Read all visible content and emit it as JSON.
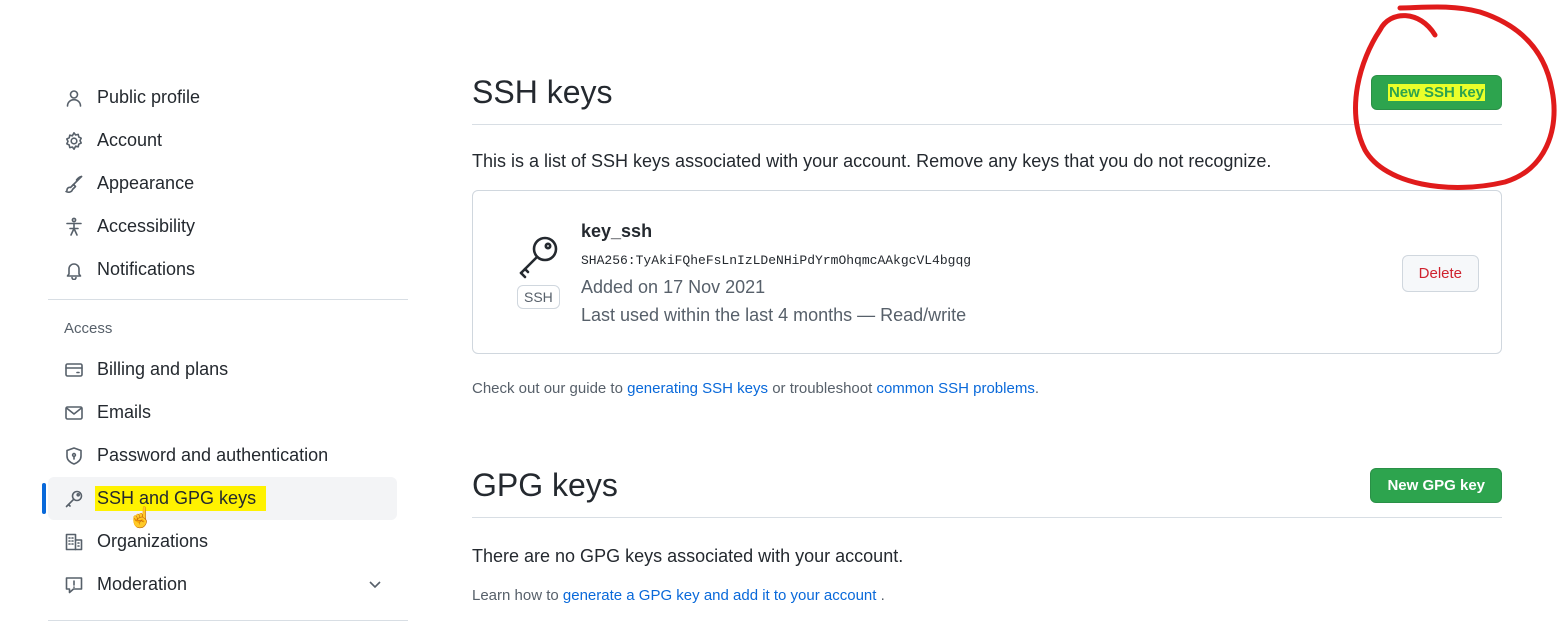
{
  "sidebar": {
    "items": [
      {
        "label": "Public profile",
        "icon": "person-icon"
      },
      {
        "label": "Account",
        "icon": "gear-icon"
      },
      {
        "label": "Appearance",
        "icon": "paintbrush-icon"
      },
      {
        "label": "Accessibility",
        "icon": "accessibility-icon"
      },
      {
        "label": "Notifications",
        "icon": "bell-icon"
      }
    ],
    "access_label": "Access",
    "access_items": [
      {
        "label": "Billing and plans",
        "icon": "credit-card-icon"
      },
      {
        "label": "Emails",
        "icon": "mail-icon"
      },
      {
        "label": "Password and authentication",
        "icon": "shield-lock-icon"
      },
      {
        "label": "SSH and GPG keys",
        "icon": "key-icon",
        "active": true
      },
      {
        "label": "Organizations",
        "icon": "organization-icon"
      },
      {
        "label": "Moderation",
        "icon": "report-icon"
      }
    ]
  },
  "ssh": {
    "title": "SSH keys",
    "new_button": "New SSH key",
    "intro": "This is a list of SSH keys associated with your account. Remove any keys that you do not recognize.",
    "key": {
      "name": "key_ssh",
      "badge": "SSH",
      "fingerprint": "SHA256:TyAkiFQheFsLnIzLDeNHiPdYrmOhqmcAAkgcVL4bgqg",
      "added": "Added on 17 Nov 2021",
      "last_used": "Last used within the last 4 months — Read/write",
      "delete_label": "Delete"
    },
    "guide_prefix": "Check out our guide to ",
    "guide_link1": "generating SSH keys",
    "guide_mid": " or troubleshoot ",
    "guide_link2": "common SSH problems",
    "guide_suffix": "."
  },
  "gpg": {
    "title": "GPG keys",
    "new_button": "New GPG key",
    "empty": "There are no GPG keys associated with your account.",
    "learn_prefix": "Learn how to ",
    "learn_link": "generate a GPG key and add it to your account",
    "learn_suffix": " ."
  },
  "colors": {
    "accent_blue": "#0969da",
    "button_green": "#2da44e",
    "annotation_red": "#e01b1b",
    "highlight_yellow": "#fff200"
  }
}
